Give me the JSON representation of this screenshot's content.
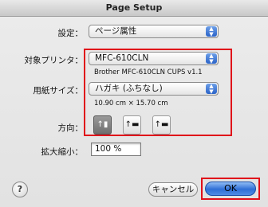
{
  "window": {
    "title": "Page Setup"
  },
  "settings": {
    "label": "設定：",
    "value": "ページ属性"
  },
  "printer": {
    "label": "対象プリンタ：",
    "value": "MFC-610CLN",
    "detail": "Brother MFC-610CLN CUPS v1.1"
  },
  "paper": {
    "label": "用紙サイズ：",
    "value": "ハガキ (ふちなし)",
    "dimensions": "10.90 cm × 15.70 cm"
  },
  "orientation": {
    "label": "方向：",
    "options": [
      "portrait",
      "landscape-left",
      "landscape-right"
    ],
    "selected": "portrait"
  },
  "scale": {
    "label": "拡大縮小：",
    "value": "100 %"
  },
  "buttons": {
    "help": "?",
    "cancel": "キャンセル",
    "ok": "OK"
  },
  "colors": {
    "highlight_box": "#e0101a",
    "ok_button": "#2f6fd6"
  }
}
